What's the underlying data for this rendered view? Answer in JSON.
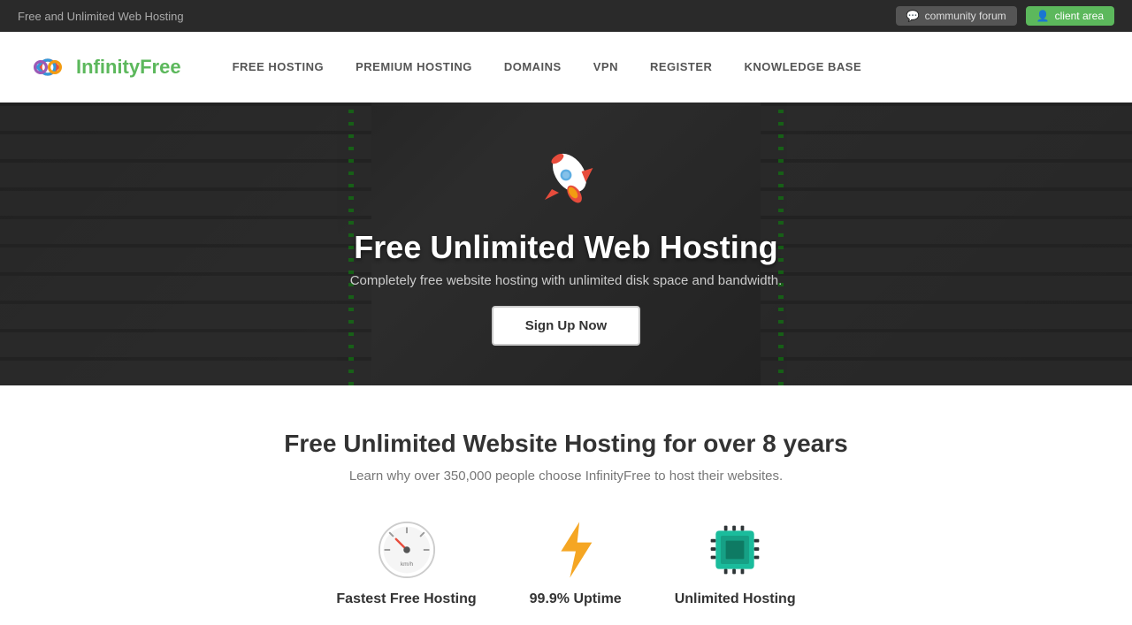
{
  "topbar": {
    "tagline": "Free and Unlimited Web Hosting",
    "community_label": "community forum",
    "client_label": "client area",
    "community_icon": "💬",
    "client_icon": "👤"
  },
  "nav": {
    "logo_text_part1": "Infinity",
    "logo_text_part2": "Free",
    "links": [
      {
        "label": "FREE HOSTING",
        "href": "#"
      },
      {
        "label": "PREMIUM HOSTING",
        "href": "#"
      },
      {
        "label": "DOMAINS",
        "href": "#"
      },
      {
        "label": "VPN",
        "href": "#"
      },
      {
        "label": "REGISTER",
        "href": "#"
      },
      {
        "label": "KNOWLEDGE BASE",
        "href": "#"
      }
    ]
  },
  "hero": {
    "title": "Free Unlimited Web Hosting",
    "subtitle": "Completely free website hosting with unlimited disk space and bandwidth.",
    "cta_label": "Sign Up Now"
  },
  "features": {
    "title": "Free Unlimited Website Hosting for over 8 years",
    "subtitle": "Learn why over 350,000 people choose InfinityFree to host their websites.",
    "items": [
      {
        "label": "Fastest Free Hosting",
        "icon_type": "speedometer"
      },
      {
        "label": "99.9% Uptime",
        "icon_type": "lightning"
      },
      {
        "label": "Unlimited Hosting",
        "icon_type": "cpu"
      }
    ]
  }
}
